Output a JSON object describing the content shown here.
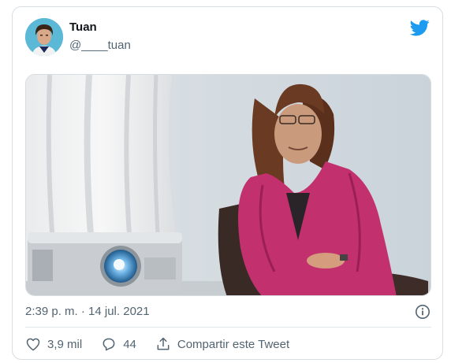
{
  "tweet": {
    "author_name": "Tuan",
    "author_handle": "@____tuan",
    "timestamp": "2:39 p. m. · 14 jul. 2021",
    "likes": "3,9 mil",
    "replies": "44",
    "share_label": "Compartir este Tweet"
  },
  "icons": {
    "brand": "twitter-bird-icon",
    "info": "info-icon",
    "like": "heart-icon",
    "reply": "reply-icon",
    "share": "share-icon"
  },
  "colors": {
    "brand": "#1d9bf0",
    "secondary_text": "#536471",
    "primary_text": "#0f1419"
  }
}
